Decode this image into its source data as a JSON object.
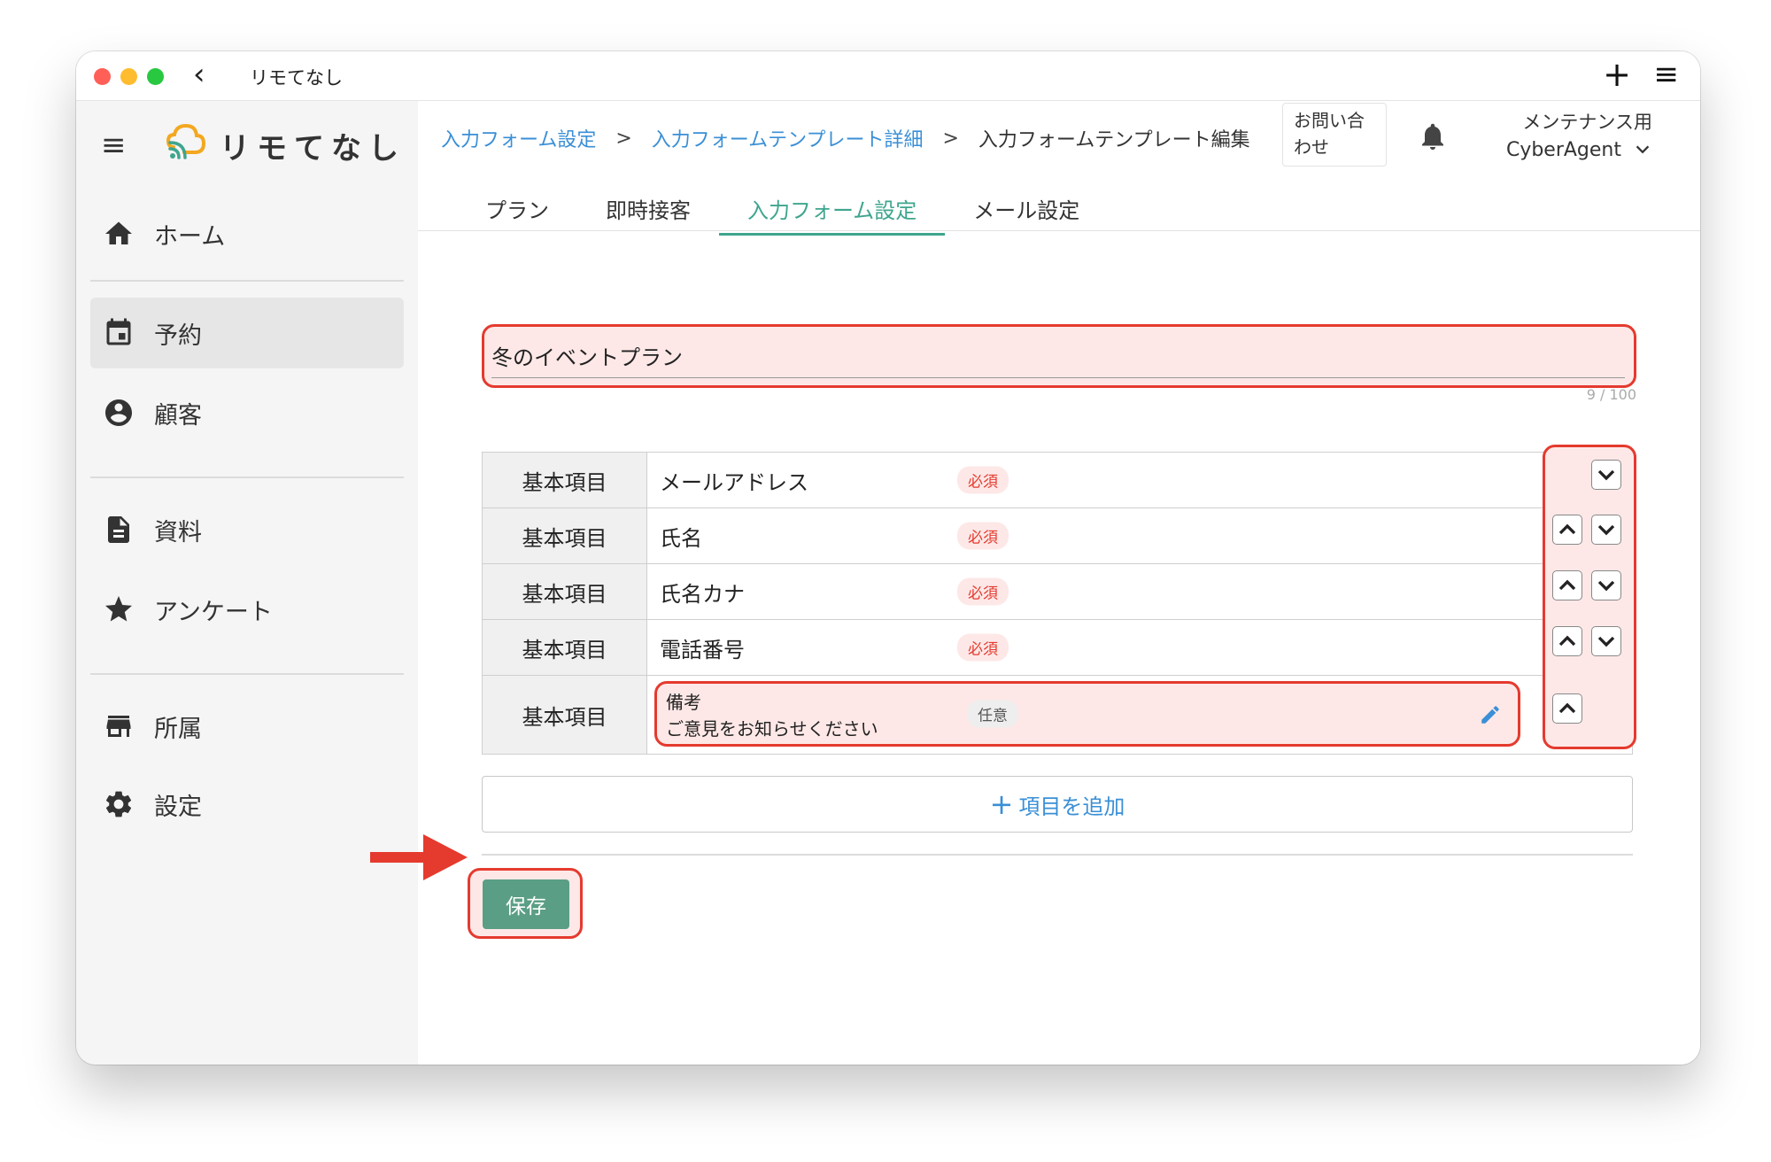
{
  "window": {
    "title": "リモてなし"
  },
  "sidebar": {
    "logo_text": "リモてなし",
    "items": [
      {
        "label": "ホーム",
        "icon": "home-icon"
      },
      {
        "label": "予約",
        "icon": "calendar-icon",
        "active": true
      },
      {
        "label": "顧客",
        "icon": "account-circle-icon"
      },
      {
        "label": "資料",
        "icon": "document-icon"
      },
      {
        "label": "アンケート",
        "icon": "star-icon"
      },
      {
        "label": "所属",
        "icon": "store-icon"
      },
      {
        "label": "設定",
        "icon": "gear-icon"
      }
    ]
  },
  "header": {
    "breadcrumb": [
      "入力フォーム設定",
      "入力フォームテンプレート詳細",
      "入力フォームテンプレート編集"
    ],
    "separator": ">",
    "contact_line1": "お問い合",
    "contact_line2": "わせ",
    "account_line1": "メンテナンス用",
    "account_org": "CyberAgent"
  },
  "tabs": [
    {
      "label": "プラン"
    },
    {
      "label": "即時接客"
    },
    {
      "label": "入力フォーム設定",
      "active": true
    },
    {
      "label": "メール設定"
    }
  ],
  "form": {
    "title_value": "冬のイベントプラン",
    "counter": "9 / 100",
    "rows": [
      {
        "category": "基本項目",
        "name": "メールアドレス",
        "badge": "必須"
      },
      {
        "category": "基本項目",
        "name": "氏名",
        "badge": "必須"
      },
      {
        "category": "基本項目",
        "name": "氏名カナ",
        "badge": "必須"
      },
      {
        "category": "基本項目",
        "name": "電話番号",
        "badge": "必須"
      },
      {
        "category": "基本項目",
        "name": "備考",
        "sub": "ご意見をお知らせください",
        "badge": "任意"
      }
    ],
    "add_label": "項目を追加",
    "add_icon": "+",
    "save_label": "保存"
  },
  "colors": {
    "accent": "#3fa58e",
    "link": "#3a8fd6",
    "highlight": "#e53a2e",
    "save": "#5a9e85"
  }
}
